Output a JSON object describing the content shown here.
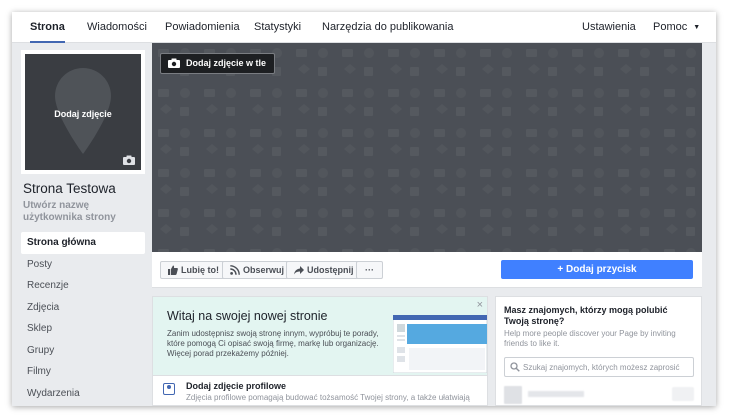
{
  "nav": {
    "tabs": [
      {
        "label": "Strona",
        "active": true
      },
      {
        "label": "Wiadomości"
      },
      {
        "label": "Powiadomienia"
      },
      {
        "label": "Statystyki"
      },
      {
        "label": "Narzędzia do publikowania"
      }
    ],
    "settings_label": "Ustawienia",
    "help_label": "Pomoc",
    "help_caret": "▼"
  },
  "profile": {
    "photo_label": "Dodaj zdjęcie",
    "page_name": "Strona Testowa",
    "username_link": "Utwórz nazwę użytkownika strony"
  },
  "sidebar": {
    "items": [
      {
        "label": "Strona główna",
        "active": true
      },
      {
        "label": "Posty"
      },
      {
        "label": "Recenzje"
      },
      {
        "label": "Zdjęcia"
      },
      {
        "label": "Sklep"
      },
      {
        "label": "Grupy"
      },
      {
        "label": "Filmy"
      },
      {
        "label": "Wydarzenia"
      }
    ]
  },
  "cover": {
    "add_cover_label": "Dodaj zdjęcie w tle",
    "background_color": "#4b4f56"
  },
  "actions": {
    "like_label": "Lubię to!",
    "follow_label": "Obserwuj",
    "share_label": "Udostępnij",
    "more_label": "···",
    "add_button_label": "+ Dodaj przycisk",
    "add_button_color": "#4080ff"
  },
  "welcome": {
    "title": "Witaj na swojej nowej stronie",
    "description": "Zanim udostępnisz swoją stronę innym, wypróbuj te porady, które pomogą Ci opisać swoją firmę, markę lub organizację. Więcej porad przekażemy później.",
    "close_label": "×",
    "task_title": "Dodaj zdjęcie profilowe",
    "task_description": "Zdjęcia profilowe pomagają budować tożsamość Twojej strony, a także ułatwiają"
  },
  "invite": {
    "title": "Masz znajomych, którzy mogą polubić Twoją stronę?",
    "subtitle": "Help more people discover your Page by inviting friends to like it.",
    "search_placeholder": "Szukaj znajomych, których możesz zaprosić"
  },
  "colors": {
    "brand_blue": "#4267b2",
    "page_bg": "#e9ebee",
    "welcome_bg": "#e3f5f1"
  }
}
